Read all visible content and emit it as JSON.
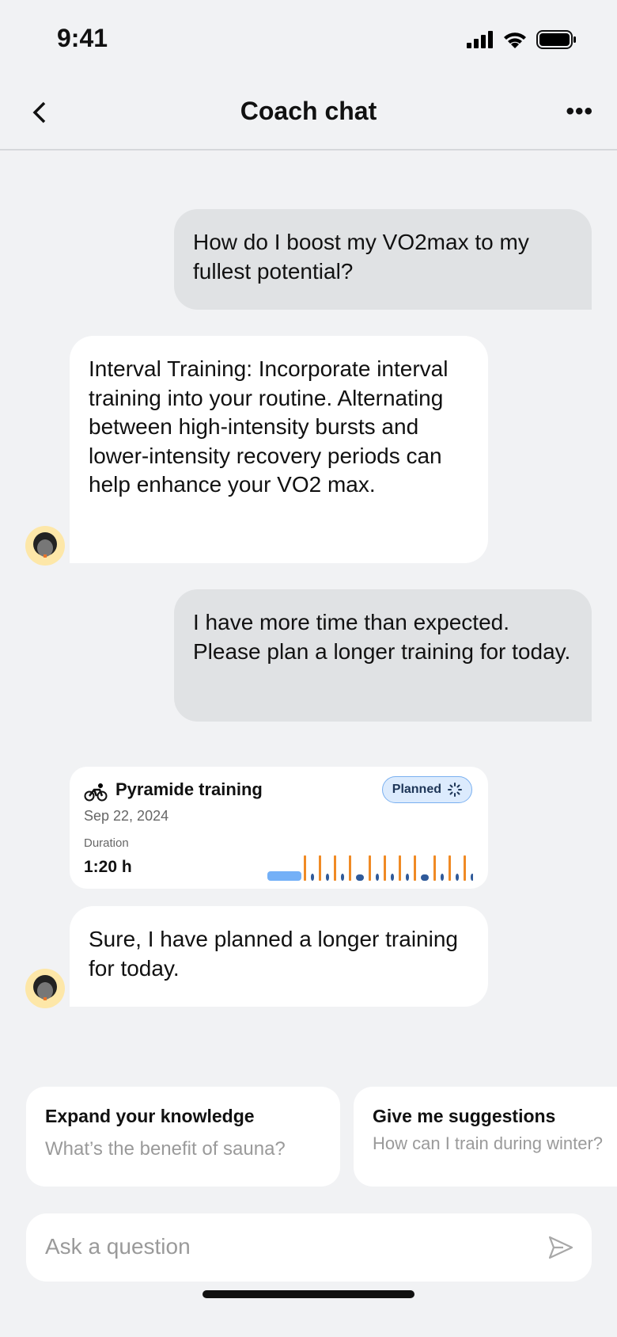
{
  "status_bar": {
    "time": "9:41"
  },
  "header": {
    "title": "Coach chat",
    "back_icon": "chevron-left-icon",
    "more_icon": "more-horizontal-icon"
  },
  "messages": [
    {
      "role": "user",
      "text": "How do I boost my VO2max to my fullest potential?"
    },
    {
      "role": "coach",
      "text": "Interval Training: Incorporate interval training into your routine. Alternating between high-intensity bursts and lower-intensity recovery periods can help enhance your VO2 max."
    },
    {
      "role": "user",
      "text": "I have more time than expected. Please plan a longer training for today."
    },
    {
      "role": "coach",
      "text": "Sure, I have planned a longer training for today."
    }
  ],
  "workout_card": {
    "icon": "bicycle-icon",
    "title": "Pyramide training",
    "date": "Sep 22, 2024",
    "status": "Planned",
    "duration_label": "Duration",
    "duration": "1:20 h",
    "profile": [
      "warmup",
      "interval",
      "recovery",
      "interval",
      "recovery",
      "interval",
      "recovery",
      "interval",
      "rest",
      "interval",
      "recovery",
      "interval",
      "recovery",
      "interval",
      "recovery",
      "interval",
      "rest",
      "interval",
      "recovery",
      "interval",
      "recovery",
      "interval",
      "recovery",
      "interval",
      "cooldown"
    ],
    "colors": {
      "warmup": "#74b0f7",
      "interval": "#f08a24",
      "recovery": "#2f5a9a",
      "rest": "#2f5a9a",
      "badge_bg": "#dcebfd"
    }
  },
  "suggestions": [
    {
      "title": "Expand your knowledge",
      "subtitle": "What’s the benefit of sauna?"
    },
    {
      "title": "Give me suggestions",
      "subtitle": "How can I train during winter?"
    }
  ],
  "composer": {
    "placeholder": "Ask a question",
    "send_icon": "send-icon"
  }
}
